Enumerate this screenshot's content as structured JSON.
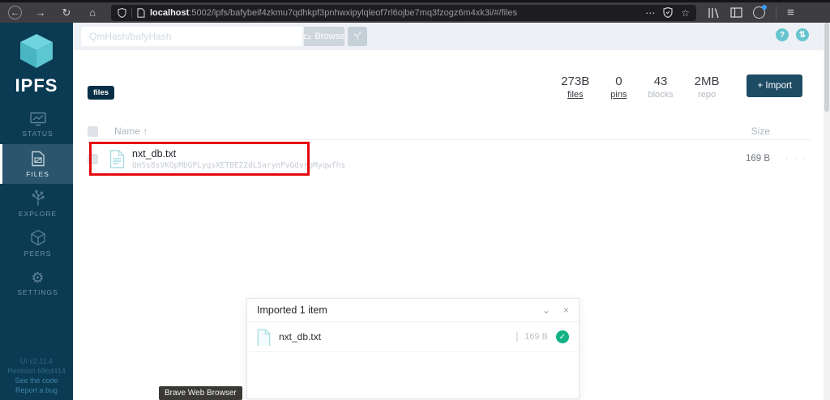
{
  "browser": {
    "url_host": "localhost",
    "url_path": ":5002/ipfs/bafybeif4zkmu7qdhkpf3pnhwxipylqleof7rl6ojbe7mq3fzogz6m4xk3i/#/files"
  },
  "glyphs": {
    "back": "←",
    "forward": "→",
    "reload": "↻",
    "home": "⌂",
    "more": "⋯",
    "star": "☆",
    "menu": "≡",
    "gear": "⚙",
    "help": "?",
    "transfer": "⇅",
    "check": "✓",
    "close": "×",
    "collapse": "⌄",
    "sort_up": "↑",
    "dots": "· · ·"
  },
  "sidebar": {
    "logo_text": "IPFS",
    "items": [
      {
        "label": "STATUS"
      },
      {
        "label": "FILES"
      },
      {
        "label": "EXPLORE"
      },
      {
        "label": "PEERS"
      },
      {
        "label": "SETTINGS"
      }
    ],
    "version": {
      "ui": "UI v2.11.4",
      "revision": "Revision 69cd414",
      "see_code": "See the code",
      "report_bug": "Report a bug"
    }
  },
  "header": {
    "search_placeholder": "QmHash/bafyHash",
    "browse_label": "Browse"
  },
  "files_page": {
    "breadcrumb": "files",
    "stats": [
      {
        "value": "273B",
        "label": "files"
      },
      {
        "value": "0",
        "label": "pins"
      },
      {
        "value": "43",
        "label": "blocks"
      },
      {
        "value": "2MB",
        "label": "repo"
      }
    ],
    "import_label": "+ Import",
    "table": {
      "name_header": "Name",
      "size_header": "Size",
      "rows": [
        {
          "name": "nxt_db.txt",
          "hash": "QmSs8sVKGpMbGPLyqsXETBEZ2dL5arynPvGdvroMyqwfhs",
          "size": "169 B"
        }
      ]
    }
  },
  "dialog": {
    "title": "Imported 1 item",
    "items": [
      {
        "name": "nxt_db.txt",
        "size": "169 B"
      }
    ]
  },
  "tooltip": "Brave Web Browser",
  "colors": {
    "accent": "#69cad3",
    "sidebar": "#0b3a53",
    "import": "#1e4b64",
    "annotation": "#e5090f",
    "success": "#11b385"
  }
}
